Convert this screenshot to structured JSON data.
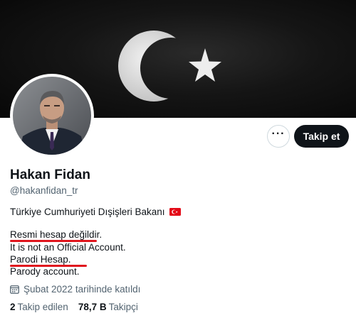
{
  "profile": {
    "name": "Hakan Fidan",
    "handle": "@hakanfidan_tr",
    "bio": "Türkiye Cumhuriyeti Dışişleri Bakanı",
    "bio_flag_icon": "turkey-flag-icon"
  },
  "actions": {
    "more_label": "···",
    "follow_label": "Takip et"
  },
  "notes": {
    "not_official_tr": "Resmi hesap değildir.",
    "not_official_en": "It is not an Official Account.",
    "parody_tr": "Parodi Hesap.",
    "parody_en": "Parody account."
  },
  "joined": {
    "icon": "calendar-icon",
    "text": "Şubat 2022 tarihinde katıldı"
  },
  "stats": {
    "following_count": "2",
    "following_label": "Takip edilen",
    "followers_count": "78,7 B",
    "followers_label": "Takipçi"
  },
  "colors": {
    "accent_underline": "#e0151d",
    "follow_button_bg": "#0f1419",
    "secondary_text": "#536471"
  }
}
